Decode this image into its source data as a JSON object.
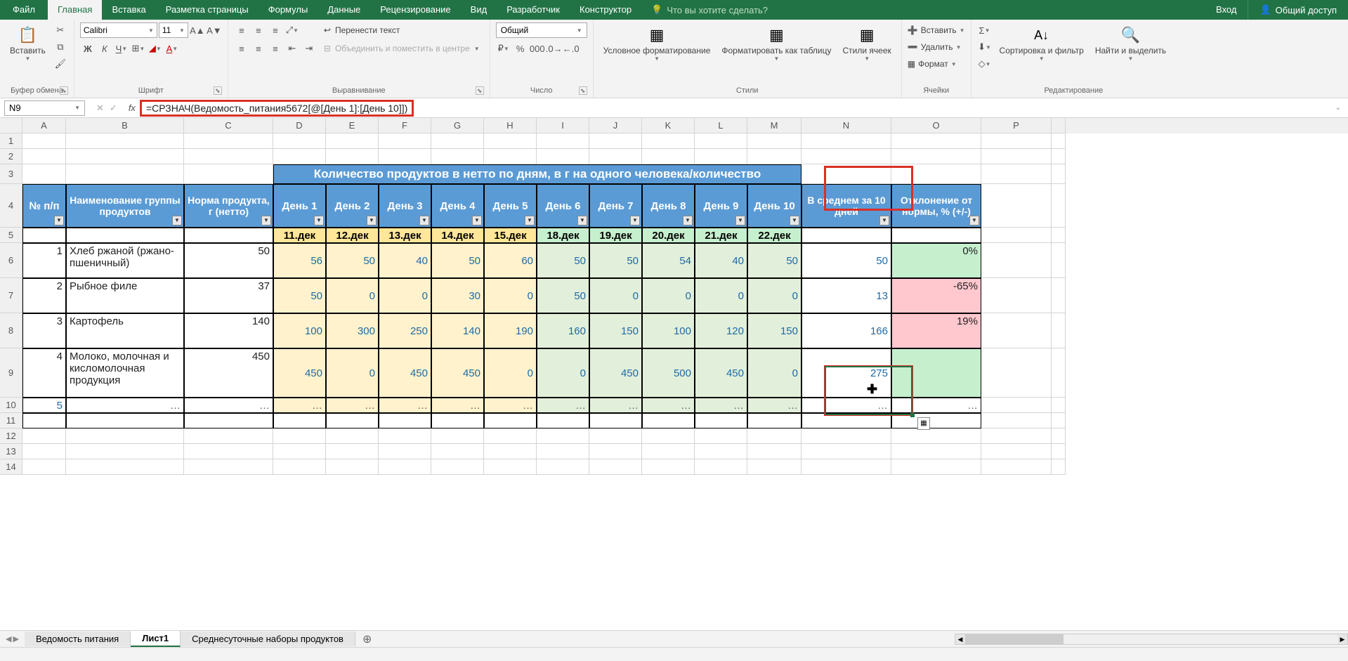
{
  "titlebar": {
    "file": "Файл",
    "tabs": [
      "Главная",
      "Вставка",
      "Разметка страницы",
      "Формулы",
      "Данные",
      "Рецензирование",
      "Вид",
      "Разработчик",
      "Конструктор"
    ],
    "tellme": "Что вы хотите сделать?",
    "signin": "Вход",
    "share": "Общий доступ"
  },
  "ribbon": {
    "clipboard": {
      "paste": "Вставить",
      "label": "Буфер обмена"
    },
    "font": {
      "name": "Calibri",
      "size": "11",
      "label": "Шрифт"
    },
    "align": {
      "wrap": "Перенести текст",
      "merge": "Объединить и поместить в центре",
      "label": "Выравнивание"
    },
    "number": {
      "format": "Общий",
      "label": "Число"
    },
    "styles": {
      "cond": "Условное форматирование",
      "tbl": "Форматировать как таблицу",
      "cell": "Стили ячеек",
      "label": "Стили"
    },
    "cells": {
      "ins": "Вставить",
      "del": "Удалить",
      "fmt": "Формат",
      "label": "Ячейки"
    },
    "editing": {
      "sort": "Сортировка и фильтр",
      "find": "Найти и выделить",
      "label": "Редактирование"
    }
  },
  "fbar": {
    "name": "N9",
    "formula": "=СРЗНАЧ(Ведомость_питания5672[@[День 1]:[День 10]])"
  },
  "cols": [
    "A",
    "B",
    "C",
    "D",
    "E",
    "F",
    "G",
    "H",
    "I",
    "J",
    "K",
    "L",
    "M",
    "N",
    "O",
    "P"
  ],
  "table": {
    "merge_title": "Количество продуктов в нетто по дням, в г на одного человека/количество",
    "h_np": "№ п/п",
    "h_name": "Наименование группы продуктов",
    "h_norm": "Норма продукта, г (нетто)",
    "h_days": [
      "День 1",
      "День 2",
      "День 3",
      "День 4",
      "День 5",
      "День 6",
      "День 7",
      "День 8",
      "День 9",
      "День 10"
    ],
    "h_avg": "В среднем за 10 дней",
    "h_dev": "Отклонение от нормы, % (+/-)",
    "dates": [
      "11.дек",
      "12.дек",
      "13.дек",
      "14.дек",
      "15.дек",
      "18.дек",
      "19.дек",
      "20.дек",
      "21.дек",
      "22.дек"
    ],
    "rows": [
      {
        "n": "1",
        "name": "Хлеб ржаной (ржано-пшеничный)",
        "norm": "50",
        "d": [
          "56",
          "50",
          "40",
          "50",
          "60",
          "50",
          "50",
          "54",
          "40",
          "50"
        ],
        "avg": "50",
        "dev": "0%",
        "devc": "g"
      },
      {
        "n": "2",
        "name": "Рыбное филе",
        "norm": "37",
        "d": [
          "50",
          "0",
          "0",
          "30",
          "0",
          "50",
          "0",
          "0",
          "0",
          "0"
        ],
        "avg": "13",
        "dev": "-65%",
        "devc": "r"
      },
      {
        "n": "3",
        "name": "Картофель",
        "norm": "140",
        "d": [
          "100",
          "300",
          "250",
          "140",
          "190",
          "160",
          "150",
          "100",
          "120",
          "150"
        ],
        "avg": "166",
        "dev": "19%",
        "devc": "r"
      },
      {
        "n": "4",
        "name": "Молоко, молочная и кисломолочная продукция",
        "norm": "450",
        "d": [
          "450",
          "0",
          "450",
          "450",
          "0",
          "0",
          "450",
          "500",
          "450",
          "0"
        ],
        "avg": "275",
        "dev": "",
        "devc": "g"
      }
    ],
    "row5n": "5",
    "dots": "…"
  },
  "sheets": {
    "s1": "Ведомость питания",
    "s2": "Лист1",
    "s3": "Среднесуточные наборы продуктов"
  }
}
